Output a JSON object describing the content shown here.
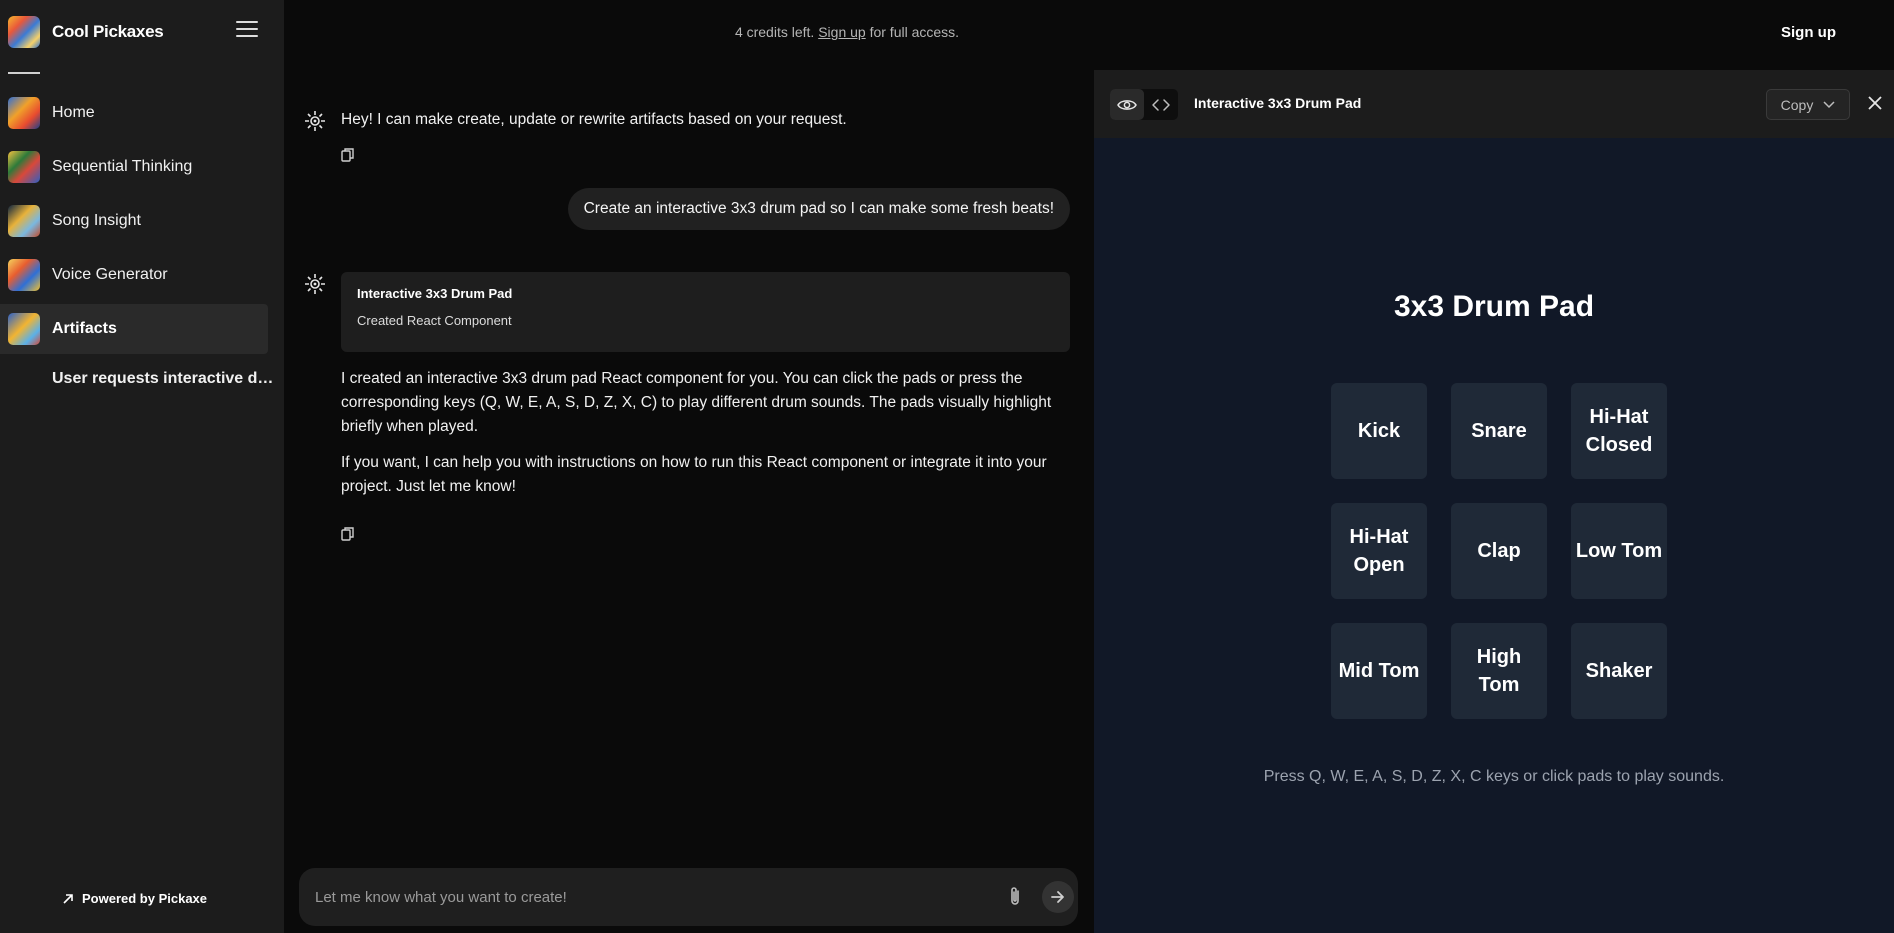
{
  "sidebar": {
    "brand": "Cool Pickaxes",
    "items": [
      {
        "label": "Home"
      },
      {
        "label": "Sequential Thinking"
      },
      {
        "label": "Song Insight"
      },
      {
        "label": "Voice Generator"
      },
      {
        "label": "Artifacts"
      }
    ],
    "sub_item": "User requests interactive drum pad",
    "powered_by": "Powered by Pickaxe"
  },
  "topbar": {
    "credits_prefix": "4 credits left.",
    "credits_link": "Sign up",
    "credits_suffix": "for full access.",
    "signup": "Sign up"
  },
  "chat": {
    "greeting": "Hey! I can make create, update or rewrite artifacts based on your request.",
    "user_message": "Create an interactive 3x3 drum pad so I can make some fresh beats!",
    "artifact_card": {
      "title": "Interactive 3x3 Drum Pad",
      "subtitle": "Created React Component"
    },
    "reply_p1": "I created an interactive 3x3 drum pad React component for you. You can click the pads or press the corresponding keys (Q, W, E, A, S, D, Z, X, C) to play different drum sounds. The pads visually highlight briefly when played.",
    "reply_p2": "If you want, I can help you with instructions on how to run this React component or integrate it into your project. Just let me know!",
    "input_placeholder": "Let me know what you want to create!"
  },
  "artifact": {
    "title": "Interactive 3x3 Drum Pad",
    "copy_label": "Copy",
    "heading": "3x3 Drum Pad",
    "pads": [
      "Kick",
      "Snare",
      "Hi-Hat Closed",
      "Hi-Hat Open",
      "Clap",
      "Low Tom",
      "Mid Tom",
      "High Tom",
      "Shaker"
    ],
    "hint": "Press Q, W, E, A, S, D, Z, X, C keys or click pads to play sounds."
  },
  "colors": {
    "sidebar_bg": "#1c1c1c",
    "main_bg": "#0a0a0a",
    "panel_bg": "#111827",
    "pad_bg": "#1f2937"
  }
}
